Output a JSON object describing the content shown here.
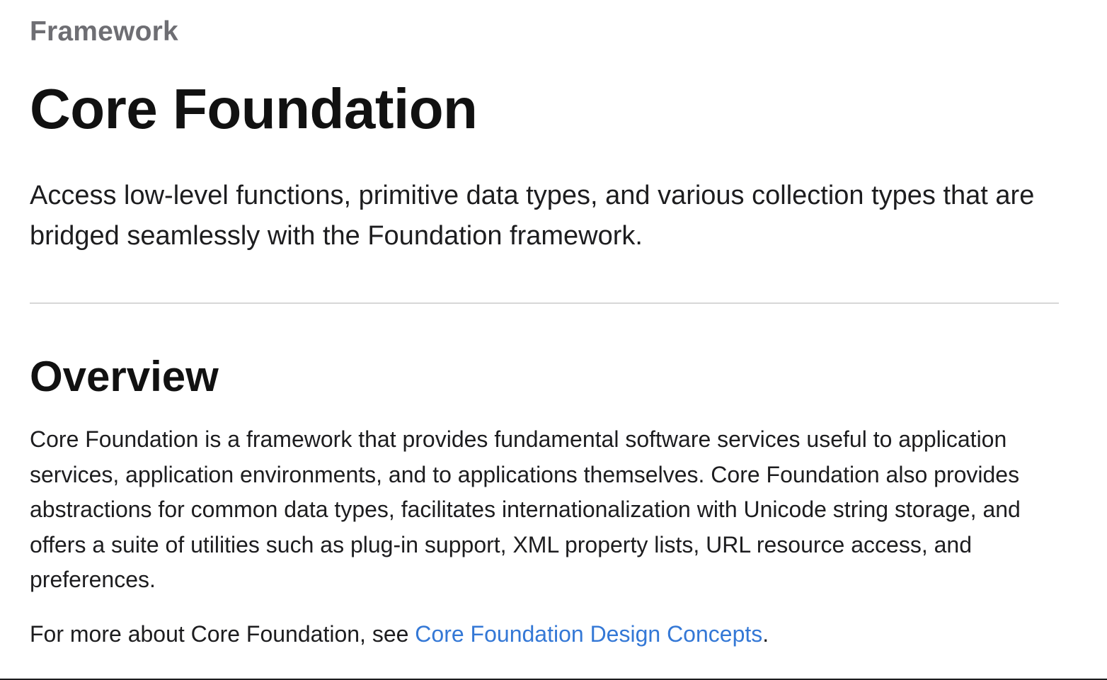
{
  "header": {
    "eyebrow": "Framework",
    "title": "Core Foundation",
    "abstract": "Access low-level functions, primitive data types, and various collection types that are bridged seamlessly with the Foundation framework."
  },
  "overview": {
    "heading": "Overview",
    "paragraph": "Core Foundation is a framework that provides fundamental software services useful to application services, application environments, and to applications themselves. Core Foundation also provides abstractions for common data types, facilitates internationalization with Unicode string storage, and offers a suite of utilities such as plug-in support, XML property lists, URL resource access, and preferences.",
    "more_prefix": "For more about Core Foundation, see ",
    "more_link": "Core Foundation Design Concepts",
    "more_suffix": "."
  },
  "colors": {
    "link": "#3478d6",
    "eyebrow": "#6e6e73",
    "divider": "#d7d7d7"
  }
}
